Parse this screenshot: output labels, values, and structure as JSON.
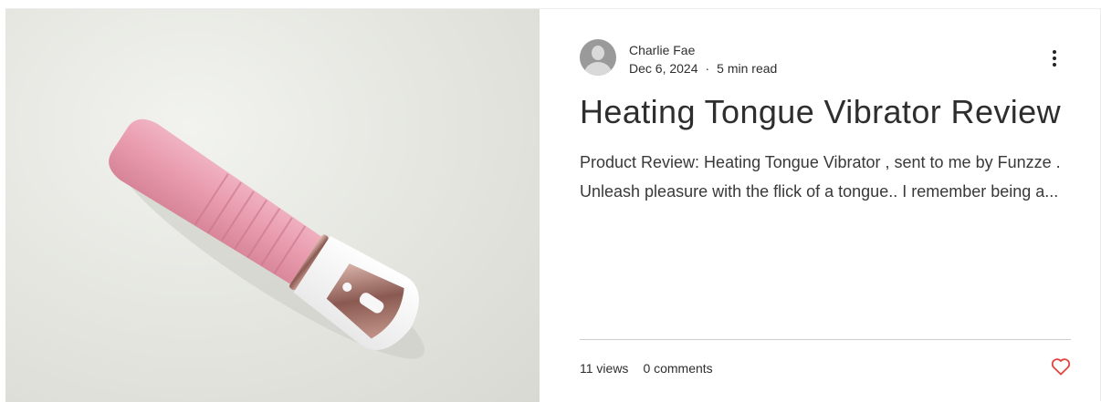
{
  "post": {
    "author": "Charlie Fae",
    "date": "Dec 6, 2024",
    "separator": "·",
    "read_time": "5 min read",
    "title": "Heating Tongue Vibrator Review",
    "excerpt": "Product Review: Heating Tongue Vibrator , sent to me by Funzze . Unleash pleasure with the flick of a tongue.. I remember being a...",
    "views": "11 views",
    "comments": "0 comments"
  },
  "icons": {
    "more": "more-vertical-icon",
    "like": "heart-icon",
    "avatar": "user-placeholder-icon"
  },
  "colors": {
    "heart": "#e0463d",
    "text": "#2f2e2e",
    "divider": "#cfcfcf"
  }
}
